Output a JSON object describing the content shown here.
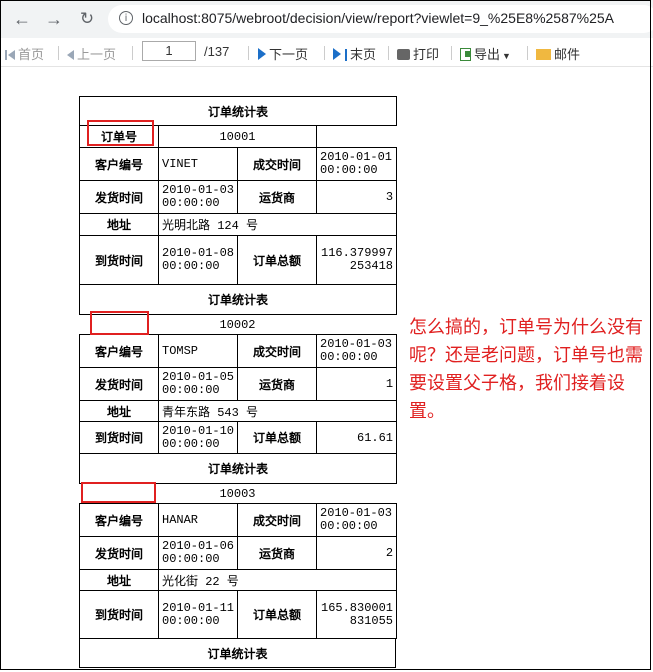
{
  "browser": {
    "back_icon": "arrow-left-icon",
    "forward_icon": "arrow-right-icon",
    "reload_icon": "reload-icon",
    "url": "localhost:8075/webroot/decision/view/report?viewlet=9_%25E8%2587%25A"
  },
  "toolbar": {
    "first": "首页",
    "prev": "上一页",
    "page": "1",
    "total": "/137",
    "next": "下一页",
    "last": "末页",
    "print": "打印",
    "export": "导出",
    "mail": "邮件"
  },
  "labels": {
    "title": "订单统计表",
    "order_id": "订单号",
    "customer": "客户编号",
    "deal_time": "成交时间",
    "ship_time": "发货时间",
    "carrier": "运货商",
    "address": "地址",
    "arrive_time": "到货时间",
    "total": "订单总额"
  },
  "orders": [
    {
      "order_id": "10001",
      "customer": "VINET",
      "deal_time": "2010-01-01\n00:00:00",
      "ship_time": "2010-01-03\n00:00:00",
      "carrier": "3",
      "address": "光明北路 124 号",
      "arrive_time": "2010-01-08\n00:00:00",
      "total": "116.379997\n253418"
    },
    {
      "order_id": "10002",
      "customer": "TOMSP",
      "deal_time": "2010-01-03\n00:00:00",
      "ship_time": "2010-01-05\n00:00:00",
      "carrier": "1",
      "address": "青年东路 543 号",
      "arrive_time": "2010-01-10\n00:00:00",
      "total": "61.61"
    },
    {
      "order_id": "10003",
      "customer": "HANAR",
      "deal_time": "2010-01-03\n00:00:00",
      "ship_time": "2010-01-06\n00:00:00",
      "carrier": "2",
      "address": "光化街 22 号",
      "arrive_time": "2010-01-11\n00:00:00",
      "total": "165.830001\n831055"
    }
  ],
  "annotation": "怎么搞的，订单号为什么没有呢？还是老问题，订单号也需要设置父子格，我们接着设置。",
  "colors": {
    "highlight": "#e02020",
    "note": "#e02020"
  }
}
